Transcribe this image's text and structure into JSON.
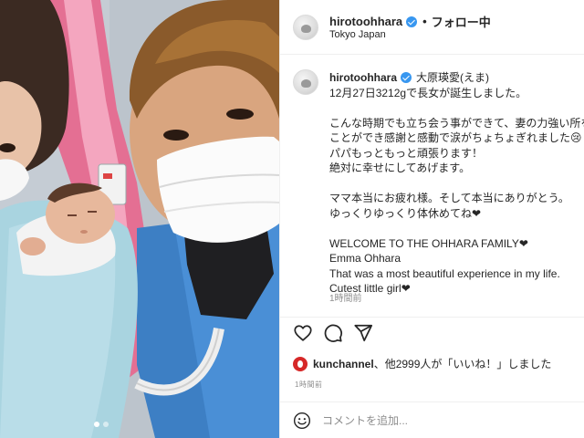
{
  "header": {
    "username": "hirotoohhara",
    "separator": "•",
    "follow_status": "フォロー中",
    "location": "Tokyo Japan"
  },
  "caption": {
    "username": "hirotoohhara",
    "display_name": "大原瑛愛(えま)",
    "lines": [
      "12月27日3212gで長女が誕生しました。",
      "",
      "こんな時期でも立ち会う事ができて、妻の力強い所を見る",
      "ことができ感謝と感動で涙がちょちょぎれました😢",
      "パパもっともっと頑張ります！",
      "絶対に幸せにしてあげます。",
      "",
      "ママ本当にお疲れ様。そして本当にありがとう。",
      "ゆっくりゆっくり体休めてね❤",
      "",
      "WELCOME TO THE OHHARA FAMILY❤",
      "Emma Ohhara",
      "That was a most beautiful experience in my life.",
      "Cutest little girl❤"
    ],
    "time_ago": "1時間前"
  },
  "actions": {
    "like_icon": "heart-outline-icon",
    "comment_icon": "comment-bubble-icon",
    "share_icon": "paper-plane-icon"
  },
  "likes": {
    "first_user": "kunchannel",
    "rest": "、他2999人が「いいね！」しました"
  },
  "post_time": "1時間前",
  "comment": {
    "emoji_icon": "smiley-face-icon",
    "placeholder": "コメントを追加..."
  },
  "photo": {
    "carousel_total": 2,
    "carousel_active": 1
  },
  "colors": {
    "verified_badge": "#3897f0",
    "text": "#262626",
    "muted": "#8e8e8e",
    "divider": "#efefef"
  }
}
